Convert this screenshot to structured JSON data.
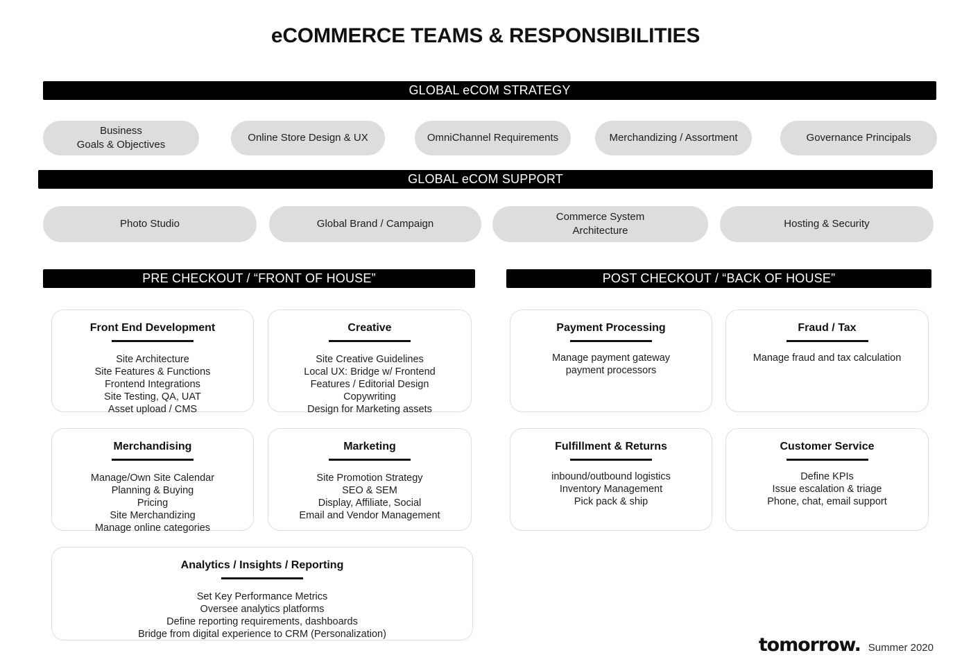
{
  "page": {
    "title": "eCOMMERCE TEAMS & RESPONSIBILITIES",
    "bg_color": "#ffffff",
    "band_color": "#000000",
    "pill_color": "#dddddd",
    "card_border_color": "#dedede"
  },
  "sections": {
    "strategy": {
      "band_label": "GLOBAL eCOM STRATEGY",
      "pills": [
        {
          "label": "Business\nGoals & Objectives",
          "line1": "Business",
          "line2": "Goals & Objectives"
        },
        {
          "label": "Online Store Design & UX",
          "line1": "Online Store Design & UX",
          "line2": ""
        },
        {
          "label": "OmniChannel Requirements",
          "line1": "OmniChannel Requirements",
          "line2": ""
        },
        {
          "label": "Merchandizing / Assortment",
          "line1": "Merchandizing / Assortment",
          "line2": ""
        },
        {
          "label": "Governance Principals",
          "line1": "Governance Principals",
          "line2": ""
        }
      ]
    },
    "support": {
      "band_label": "GLOBAL eCOM SUPPORT",
      "pills": [
        {
          "line1": "Photo Studio",
          "line2": ""
        },
        {
          "line1": "Global Brand / Campaign",
          "line2": ""
        },
        {
          "line1": "Commerce System",
          "line2": "Architecture"
        },
        {
          "line1": "Hosting & Security",
          "line2": ""
        }
      ]
    },
    "pre_checkout": {
      "band_label": "PRE CHECKOUT / “FRONT OF HOUSE”",
      "cards": [
        {
          "title": "Front End Development",
          "lines": [
            "Site Architecture",
            "Site Features & Functions",
            "Frontend Integrations",
            "Site Testing, QA, UAT",
            "Asset upload / CMS"
          ]
        },
        {
          "title": "Creative",
          "lines": [
            "Site Creative Guidelines",
            "Local UX: Bridge w/ Frontend",
            "Features / Editorial Design",
            "Copywriting",
            "Design for Marketing assets"
          ]
        },
        {
          "title": "Merchandising",
          "lines": [
            "Manage/Own Site Calendar",
            "Planning & Buying",
            "Pricing",
            "Site Merchandizing",
            "Manage online categories"
          ]
        },
        {
          "title": "Marketing",
          "lines": [
            "Site Promotion Strategy",
            "SEO & SEM",
            "Display, Affiliate, Social",
            "Email and Vendor Management"
          ]
        },
        {
          "title": "Analytics / Insights / Reporting",
          "lines": [
            "Set Key Performance Metrics",
            "Oversee analytics platforms",
            "Define reporting requirements, dashboards",
            "Bridge from digital experience to CRM (Personalization)"
          ]
        }
      ]
    },
    "post_checkout": {
      "band_label": "POST CHECKOUT / “BACK OF HOUSE”",
      "cards": [
        {
          "title": "Payment Processing",
          "lines": [
            "Manage payment gateway",
            "payment processors"
          ]
        },
        {
          "title": "Fraud / Tax",
          "lines": [
            "Manage fraud and tax calculation"
          ]
        },
        {
          "title": "Fulfillment & Returns",
          "lines": [
            "inbound/outbound logistics",
            "Inventory Management",
            "Pick pack & ship"
          ]
        },
        {
          "title": "Customer Service",
          "lines": [
            "Define KPIs",
            "Issue escalation & triage",
            "Phone, chat, email support"
          ]
        }
      ]
    }
  },
  "footer": {
    "brand": "tomorrow.",
    "date": "Summer 2020"
  }
}
